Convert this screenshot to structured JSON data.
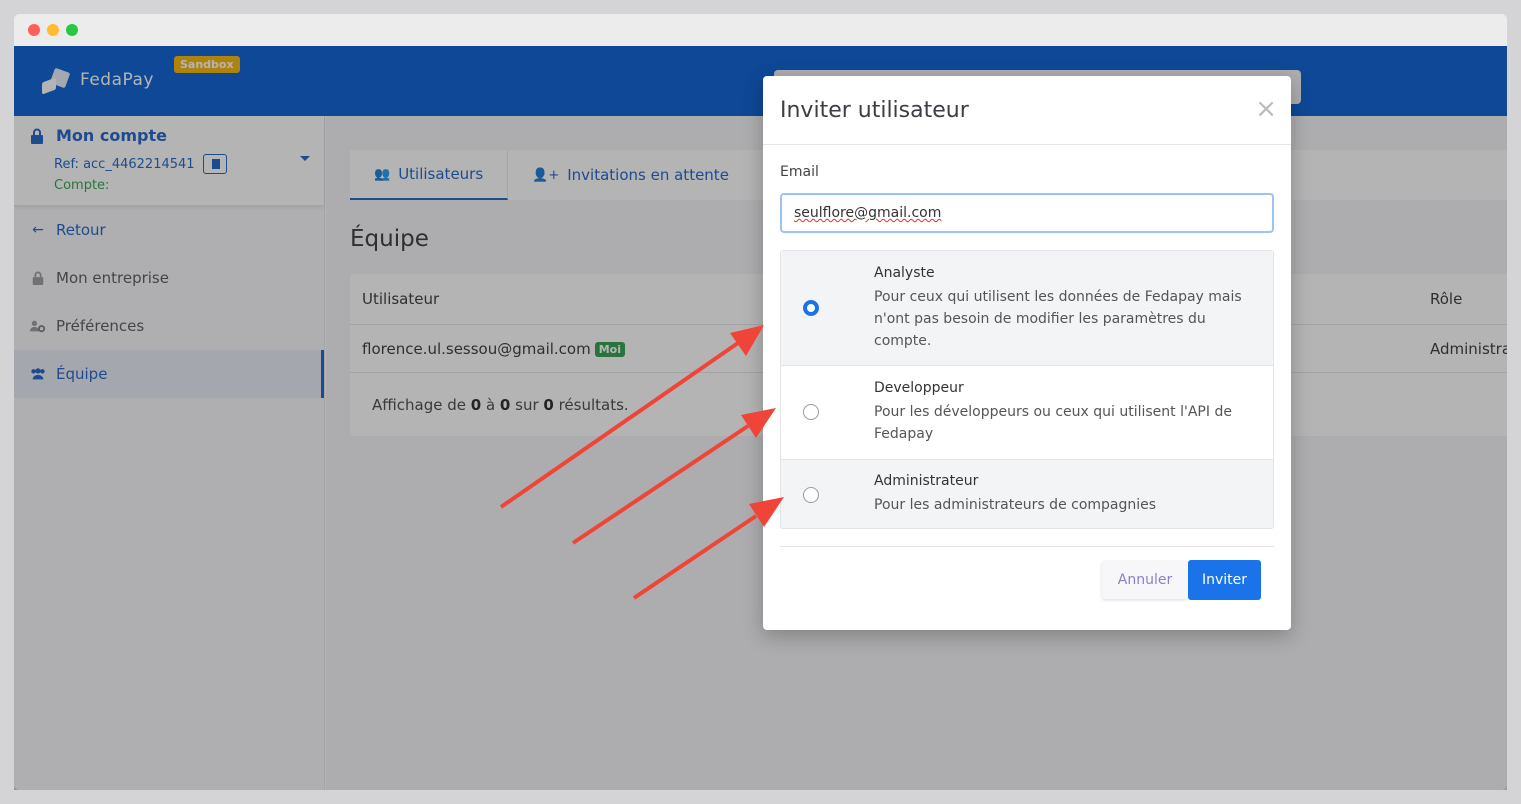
{
  "app": {
    "name": "FedaPay",
    "env_badge": "Sandbox"
  },
  "account": {
    "title": "Mon compte",
    "ref": "Ref: acc_4462214541",
    "compte_label": "Compte:"
  },
  "sidebar": {
    "items": [
      {
        "label": "Retour",
        "icon": "arrow-left-icon"
      },
      {
        "label": "Mon entreprise",
        "icon": "lock-icon"
      },
      {
        "label": "Préférences",
        "icon": "users-gear-icon"
      },
      {
        "label": "Équipe",
        "icon": "users-icon",
        "active": true
      }
    ]
  },
  "main": {
    "tabs": [
      {
        "label": "Utilisateurs",
        "active": true
      },
      {
        "label": "Invitations en attente"
      }
    ],
    "title": "Équipe",
    "table": {
      "headers": {
        "user": "Utilisateur",
        "role": "Rôle"
      },
      "rows": [
        {
          "email": "florence.ul.sessou@gmail.com",
          "badge": "Moi",
          "role": "Administrateur"
        }
      ],
      "summary": {
        "pre": "Affichage de ",
        "from": "0",
        "mid1": " à ",
        "to": "0",
        "mid2": " sur ",
        "total": "0",
        "post": " résultats."
      }
    }
  },
  "modal": {
    "title": "Inviter utilisateur",
    "close": "×",
    "email_label": "Email",
    "email_value": "seulflore@gmail.com",
    "roles": [
      {
        "name": "Analyste",
        "desc": "Pour ceux qui utilisent les données de Fedapay mais n'ont pas besoin de modifier les paramètres du compte.",
        "checked": true
      },
      {
        "name": "Developpeur",
        "desc": "Pour les développeurs ou ceux qui utilisent l'API de Fedapay",
        "checked": false
      },
      {
        "name": "Administrateur",
        "desc": "Pour les administrateurs de compagnies",
        "checked": false
      }
    ],
    "cancel_label": "Annuler",
    "invite_label": "Inviter"
  },
  "colors": {
    "brand": "#005ad2",
    "accent": "#1a73e8",
    "badge": "#f5b400",
    "arrow": "#f04438"
  }
}
